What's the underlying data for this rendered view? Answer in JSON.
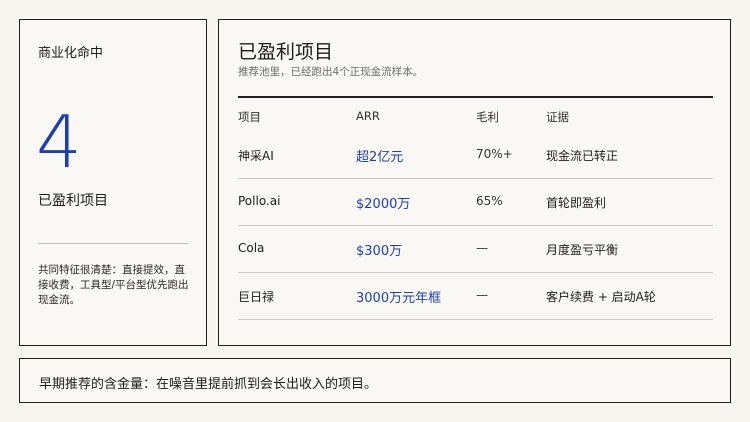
{
  "left": {
    "label": "商业化命中",
    "number": "4",
    "caption": "已盈利项目",
    "note": "共同特征很清楚：直接提效，直接收费，工具型/平台型优先跑出现金流。"
  },
  "main": {
    "title": "已盈利项目",
    "subtitle": "推荐池里，已经跑出4个正现金流样本。",
    "headers": [
      "项目",
      "ARR",
      "毛利",
      "证据"
    ],
    "rows": [
      {
        "project": "神采AI",
        "arr": "超2亿元",
        "margin": "70%+",
        "evidence": "现金流已转正"
      },
      {
        "project": "Pollo.ai",
        "arr": "$2000万",
        "margin": "65%",
        "evidence": "首轮即盈利"
      },
      {
        "project": "Cola",
        "arr": "$300万",
        "margin": "—",
        "evidence": "月度盈亏平衡"
      },
      {
        "project": "巨日禄",
        "arr": "3000万元年框",
        "margin": "—",
        "evidence": "客户续费 + 启动A轮"
      }
    ]
  },
  "footer": {
    "text": "早期推荐的含金量：在噪音里提前抓到会长出收入的项目。"
  },
  "colors": {
    "accent": "#1f3ea8",
    "border": "#1f1f1f",
    "background": "#f7f5f0"
  }
}
